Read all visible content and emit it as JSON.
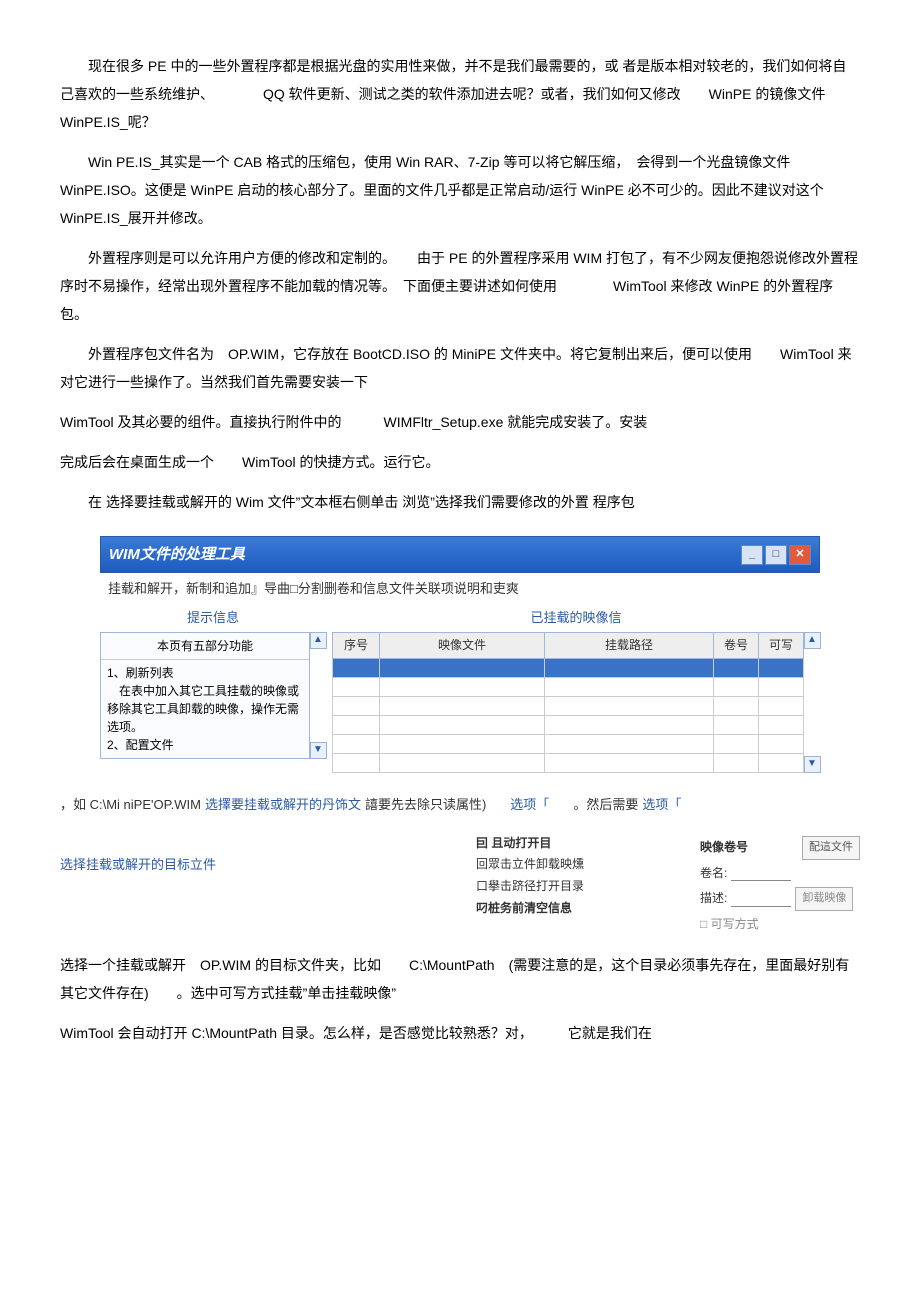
{
  "para1": "现在很多 PE 中的一些外置程序都是根据光盘的实用性来做，并不是我们最需要的，或 者是版本相对较老的，我们如何将自己喜欢的一些系统维护、　　　　QQ 软件更新、测试之类的软件添加进去呢？或者，我们如何又修改　　WinPE 的镜像文件 WinPE.IS_呢？",
  "para2": "Win PE.IS_其实是一个 CAB 格式的压缩包，使用 Win RAR、7-Zip 等可以将它解压缩，　会得到一个光盘镜像文件　　　WinPE.ISO。这便是 WinPE 启动的核心部分了。里面的文件几乎都是正常启动/运行 WinPE 必不可少的。因此不建议对这个　　　WinPE.IS_展开并修改。",
  "para3": "外置程序则是可以允许用户方便的修改和定制的。　　由于 PE 的外置程序采用 WIM 打包了，有不少网友便抱怨说修改外置程序时不易操作，经常出现外置程序不能加载的情况等。　下面便主要讲述如何使用　　　　WimTool 来修改 WinPE 的外置程序包。",
  "para4": "外置程序包文件名为　OP.WIM，它存放在 BootCD.ISO 的 MiniPE 文件夹中。将它复制出来后，便可以使用　　WimTool 来对它进行一些操作了。当然我们首先需要安装一下",
  "para5": "WimTool 及其必要的组件。直接执行附件中的　　　WIMFltr_Setup.exe 就能完成安装了。安装",
  "para6": "完成后会在桌面生成一个　　WimTool 的快捷方式。运行它。",
  "para7": "在 选择要挂载或解开的 Wim 文件”文本框右侧单击 浏览”选择我们需要修改的外置 程序包",
  "window": {
    "title": "WIM文件的处理工具",
    "min": "_",
    "max": "□",
    "close": "✕",
    "tabs": "挂载和解开，新制和追加』导曲□分割删卷和信息文件关联项说明和吏爽",
    "tips_title": "提示信息",
    "tips_header": "本页有五部分功能",
    "tips_body": "1、刷新列表\n　在表中加入其它工具挂载的映像或移除其它工具卸载的映像，操作无需选项。\n2、配置文件",
    "table_title": "已挂载的映像信",
    "columns": [
      "序号",
      "映像文件",
      "挂载路径",
      "卷号",
      "可写"
    ]
  },
  "below": {
    "line1_left": "，如 C:\\Mi niPE'OP.WIM",
    "line1_blue": "选擇要挂载或解开的丹饰文",
    "line1_mid": "譆要先去除只读属性)",
    "line1_opt1": "选项「",
    "line1_after": "。然后需要",
    "line1_opt2": "选项「",
    "line2_blue": "选择挂载或解开的目标立件",
    "opts": {
      "o1": "囙 且动打开目",
      "o2": "回眾击立件卸载映燻",
      "o3": "口擧击跻径打开目录",
      "o4": "叼桩务前清空信息"
    },
    "right": {
      "label_vol": "映像卷号",
      "btn_cfg": "配這文件",
      "label_name": "卷名:",
      "label_desc": "描述:",
      "btn_unmount": "卸载映像",
      "label_rw": "□ 可写方式"
    }
  },
  "para8": "选择一个挂载或解开　OP.WIM 的目标文件夹，比如　　C:\\MountPath　(需要注意的是，这个目录必须事先存在，里面最好别有其它文件存在)　　。选中可写方式挂载”单击挂载映像”",
  "para9": "WimTool 会自动打开 C:\\MountPath 目录。怎么样，是否感觉比较熟悉？对，　　　它就是我们在"
}
